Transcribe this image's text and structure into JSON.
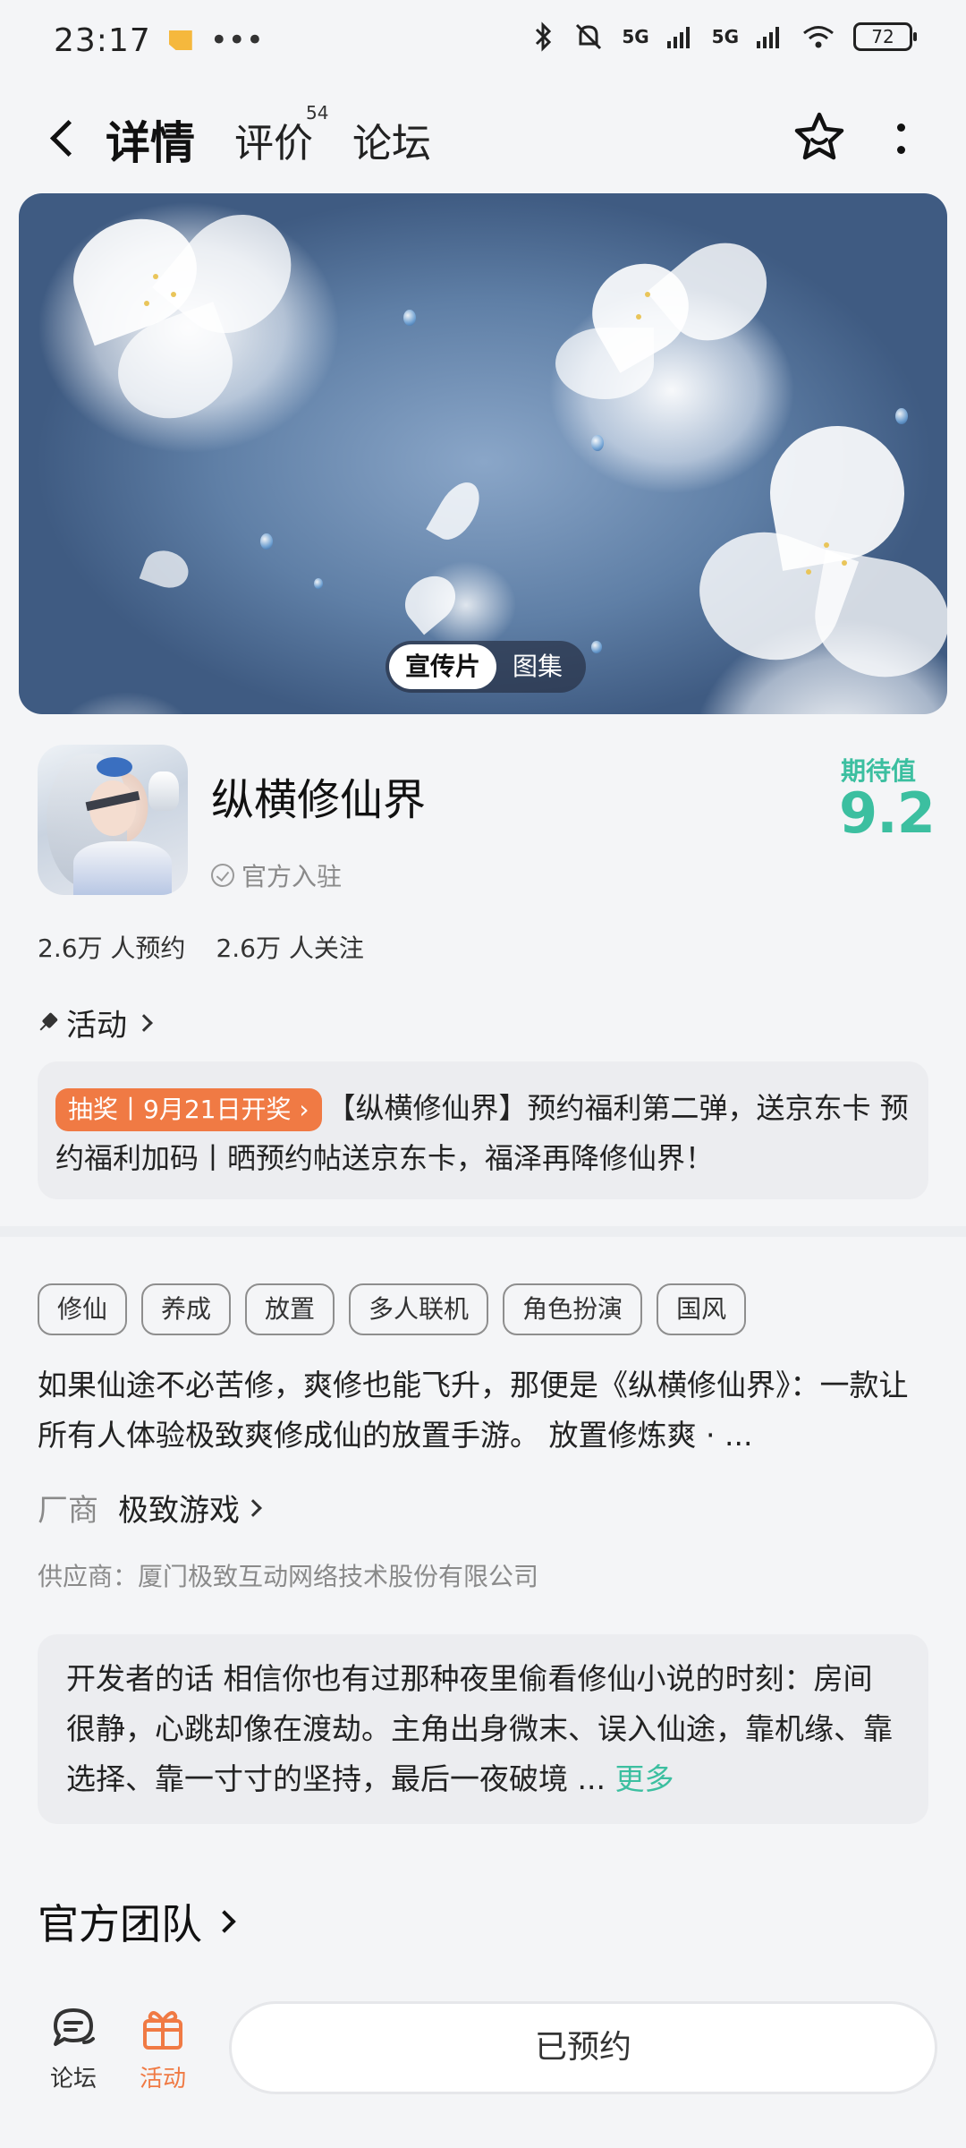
{
  "status_bar": {
    "time": "23:17",
    "dots": "•••",
    "signal1": "5G",
    "signal2": "5G",
    "battery": "72"
  },
  "nav": {
    "tabs": [
      {
        "label": "详情"
      },
      {
        "label": "评价",
        "count": "54"
      },
      {
        "label": "论坛"
      }
    ]
  },
  "banner": {
    "toggle": [
      "宣传片",
      "图集"
    ]
  },
  "game": {
    "title": "纵横修仙界",
    "official_label": "官方入驻",
    "expect_label": "期待值",
    "expect_score": "9.2",
    "stats": [
      "2.6万 人预约",
      "2.6万 人关注"
    ]
  },
  "activity": {
    "heading": "活动",
    "badge": "抽奖丨9月21日开奖 ›",
    "text": "【纵横修仙界】预约福利第二弹，送京东卡 预约福利加码丨晒预约帖送京东卡，福泽再降修仙界！"
  },
  "tags": [
    "修仙",
    "养成",
    "放置",
    "多人联机",
    "角色扮演",
    "国风"
  ],
  "description": "如果仙途不必苦修，爽修也能飞升，那便是《纵横修仙界》：一款让所有人体验极致爽修成仙的放置手游。 放置修炼爽 · ...",
  "vendor": {
    "label": "厂商",
    "name": "极致游戏"
  },
  "supplier": "供应商：厦门极致互动网络技术股份有限公司",
  "developer_note": {
    "text": "开发者的话  相信你也有过那种夜里偷看修仙小说的时刻：房间很静，心跳却像在渡劫。主角出身微末、误入仙途，靠机缘、靠选择、靠一寸寸的坚持，最后一夜破境 ...",
    "more": "更多"
  },
  "team": {
    "label": "官方团队"
  },
  "bottom_bar": {
    "forum_label": "论坛",
    "activity_label": "活动",
    "reserve_button": "已预约"
  },
  "colors": {
    "accent": "#3cbfa0",
    "lottery": "#f07a44"
  },
  "icons": [
    "back-icon",
    "star-icon",
    "more-icon",
    "check-icon",
    "pin-icon",
    "forum-icon",
    "gift-icon"
  ]
}
